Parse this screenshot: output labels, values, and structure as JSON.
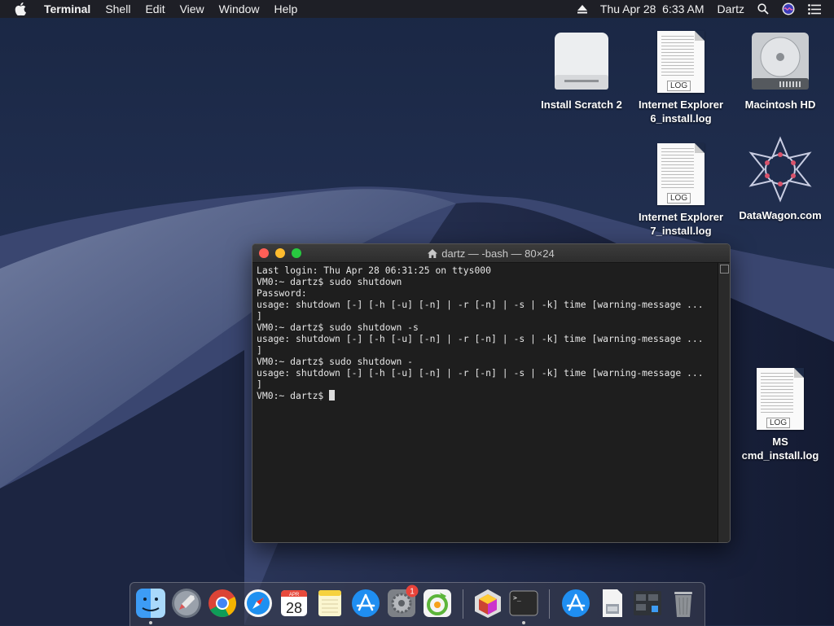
{
  "menubar": {
    "app_name": "Terminal",
    "menus": [
      "Shell",
      "Edit",
      "View",
      "Window",
      "Help"
    ],
    "datetime": "Thu Apr 28  6:33 AM",
    "user": "Dartz"
  },
  "desktop_icons": [
    {
      "label_line1": "Install Scratch 2",
      "label_line2": "",
      "icon": "external-drive-icon"
    },
    {
      "label_line1": "Internet Explorer",
      "label_line2": "6_install.log",
      "icon": "log-file-icon"
    },
    {
      "label_line1": "Macintosh HD",
      "label_line2": "",
      "icon": "hard-drive-icon"
    },
    {
      "label_line1": "Internet Explorer",
      "label_line2": "7_install.log",
      "icon": "log-file-icon"
    },
    {
      "label_line1": "DataWagon.com",
      "label_line2": "",
      "icon": "datawagon-icon"
    },
    {
      "label_line1": "MS",
      "label_line2": "cmd_install.log",
      "icon": "log-file-icon"
    }
  ],
  "log_tag": "LOG",
  "terminal": {
    "title": "dartz — -bash — 80×24",
    "lines": [
      "Last login: Thu Apr 28 06:31:25 on ttys000",
      "VM0:~ dartz$ sudo shutdown",
      "Password:",
      "usage: shutdown [-] [-h [-u] [-n] | -r [-n] | -s | -k] time [warning-message ...",
      "]",
      "VM0:~ dartz$ sudo shutdown -s",
      "usage: shutdown [-] [-h [-u] [-n] | -r [-n] | -s | -k] time [warning-message ...",
      "]",
      "VM0:~ dartz$ sudo shutdown -",
      "usage: shutdown [-] [-h [-u] [-n] | -r [-n] | -s | -k] time [warning-message ...",
      "]"
    ],
    "prompt": "VM0:~ dartz$ "
  },
  "dock": {
    "apps": [
      "finder-icon",
      "launchpad-icon",
      "chrome-icon",
      "safari-icon",
      "calendar-icon",
      "notes-icon",
      "app-store-icon",
      "system-preferences-icon",
      "scratch-icon",
      "colorsync-icon",
      "terminal-icon",
      "app-store-downloads-icon",
      "installer-icon",
      "screenshot-folder-icon",
      "trash-icon"
    ],
    "calendar_month": "APR",
    "calendar_day": "28",
    "prefs_badge": "1",
    "terminal_prompt": ">_"
  },
  "colors": {
    "close": "#fe5f57",
    "minimize": "#febc2e",
    "zoom": "#28c840"
  }
}
